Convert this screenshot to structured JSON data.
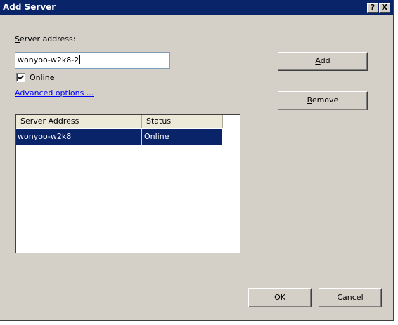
{
  "window": {
    "title": "Add Server",
    "help_glyph": "?",
    "close_glyph": "X"
  },
  "form": {
    "address_label": "Server address:",
    "address_value": "wonyoo-w2k8-2",
    "online_label": "Online",
    "online_checked": true,
    "advanced_link": "Advanced options ..."
  },
  "buttons": {
    "add": "Add",
    "remove": "Remove",
    "ok": "OK",
    "cancel": "Cancel"
  },
  "table": {
    "columns": [
      "Server Address",
      "Status"
    ],
    "rows": [
      {
        "address": "wonyoo-w2k8",
        "status": "Online",
        "selected": true
      }
    ]
  },
  "colors": {
    "titlebar": "#0a246a",
    "selection": "#0a246a",
    "dialog_face": "#d4d0c8",
    "link": "#0000ff"
  },
  "icons": {
    "help": "help-icon",
    "close": "close-icon",
    "check": "checkmark-icon"
  }
}
